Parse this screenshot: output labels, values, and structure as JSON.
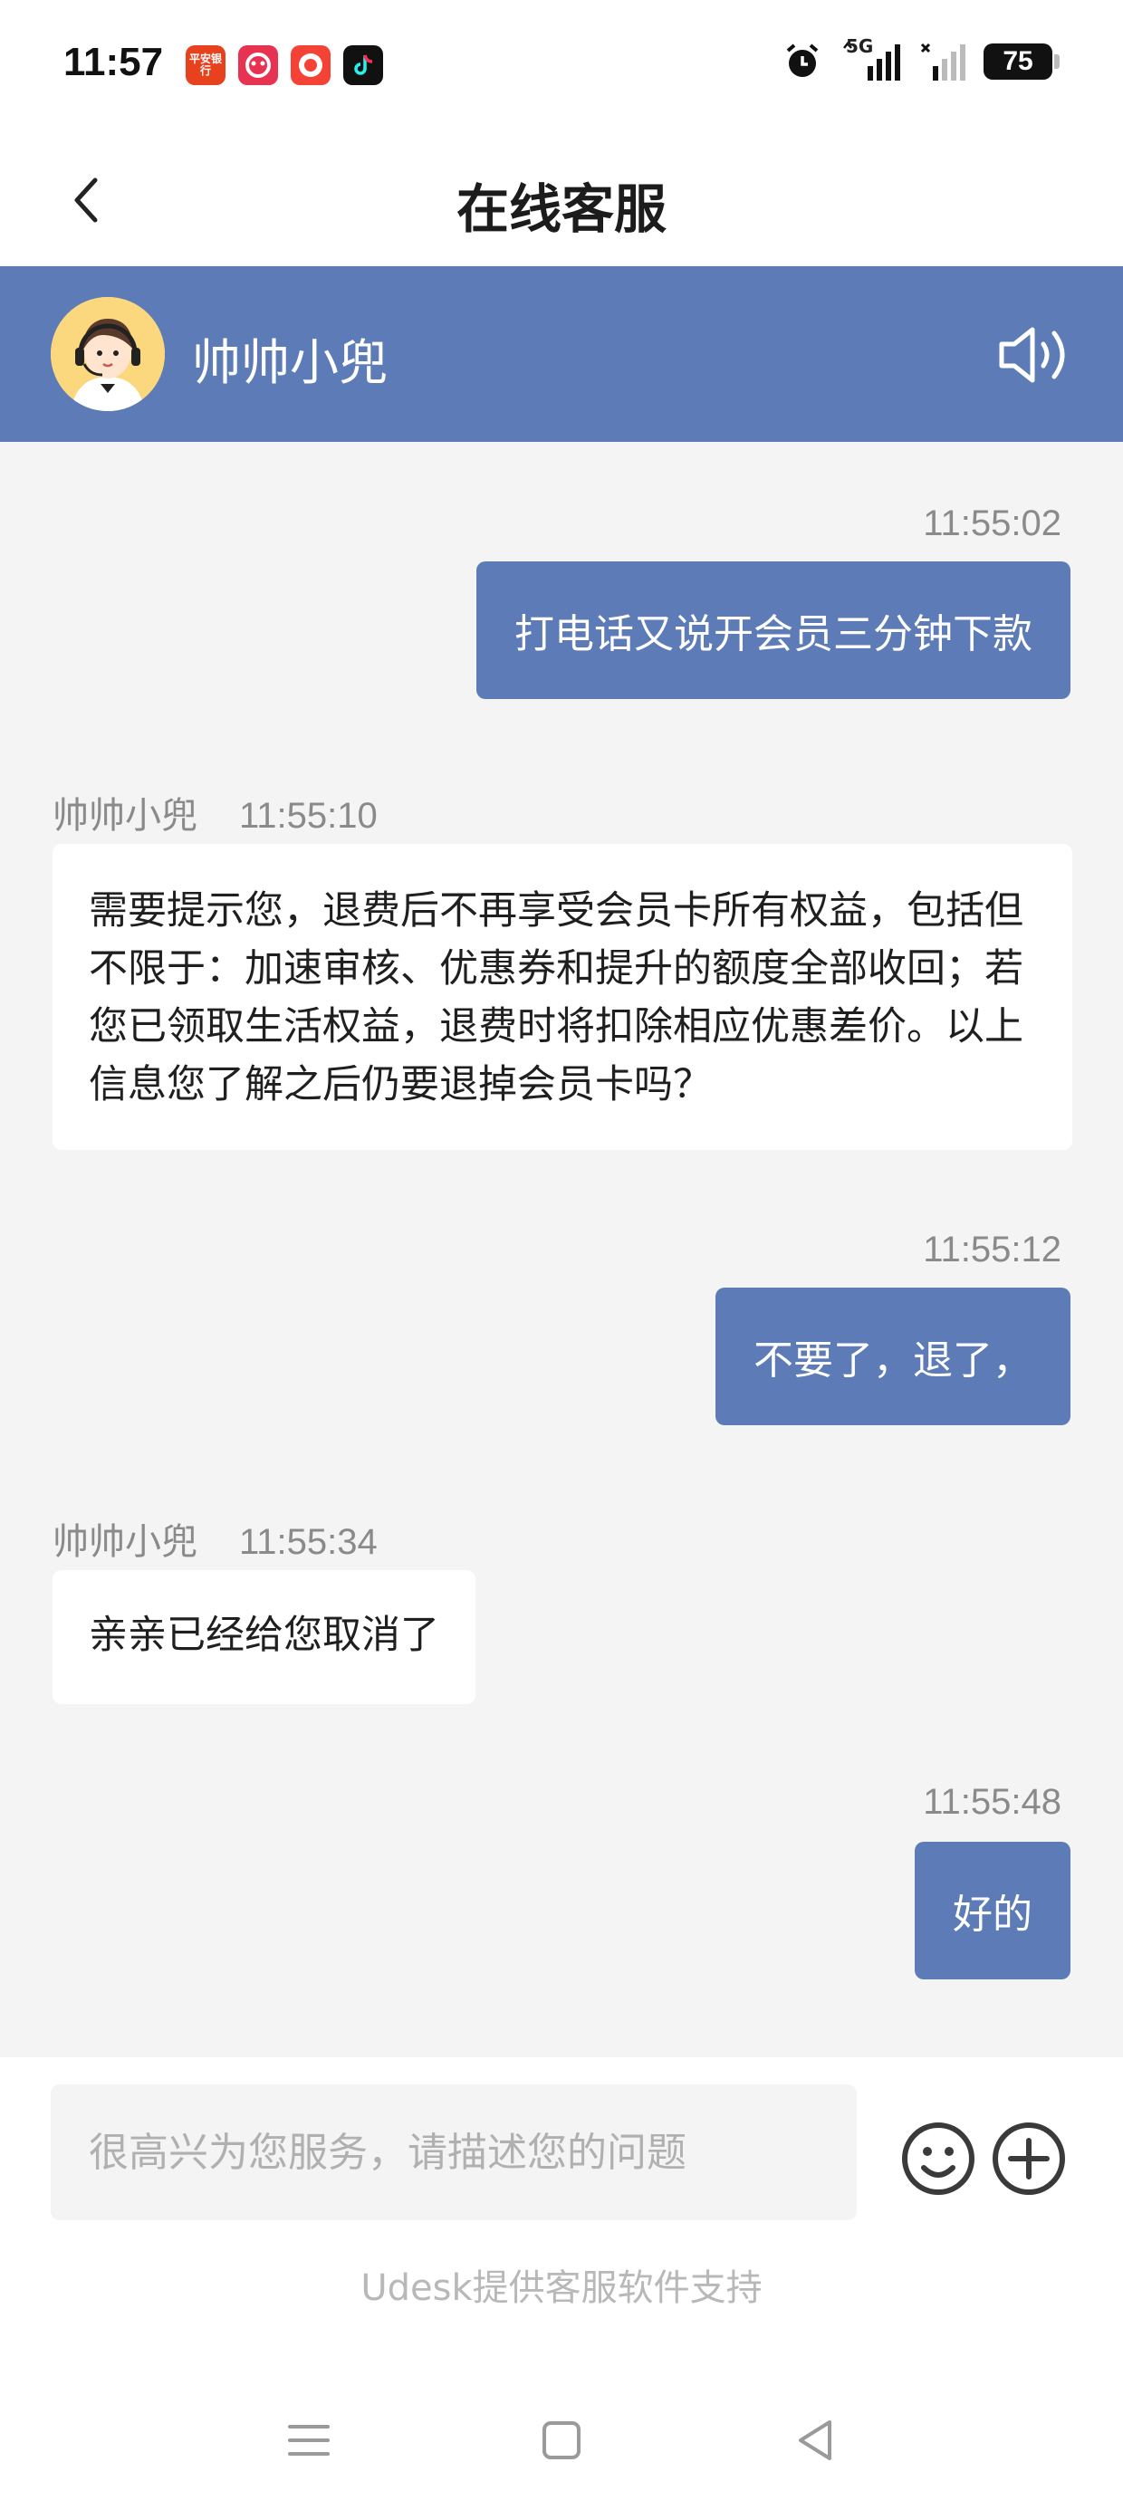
{
  "status_bar": {
    "time": "11:57",
    "apps": [
      {
        "name": "pingan-bank-icon",
        "label": "平安银行"
      },
      {
        "name": "tmall-icon",
        "label": ""
      },
      {
        "name": "pinduoduo-icon",
        "label": ""
      },
      {
        "name": "tiktok-icon",
        "label": ""
      }
    ],
    "battery": "75",
    "network": "5G"
  },
  "header": {
    "title": "在线客服"
  },
  "agent": {
    "name": "帅帅小兜"
  },
  "messages": [
    {
      "from": "user",
      "time": "11:55:02",
      "text": "打电话又说开会员三分钟下款"
    },
    {
      "from": "agent",
      "sender": "帅帅小兜",
      "time": "11:55:10",
      "text": "需要提示您，退费后不再享受会员卡所有权益，包括但不限于：加速审核、优惠券和提升的额度全部收回；若您已领取生活权益，退费时将扣除相应优惠差价。以上信息您了解之后仍要退掉会员卡吗？"
    },
    {
      "from": "user",
      "time": "11:55:12",
      "text": "不要了，退了，"
    },
    {
      "from": "agent",
      "sender": "帅帅小兜",
      "time": "11:55:34",
      "text": "亲亲已经给您取消了"
    },
    {
      "from": "user",
      "time": "11:55:48",
      "text": "好的"
    }
  ],
  "composer": {
    "placeholder": "很高兴为您服务，请描述您的问题",
    "powered_by": "Udesk提供客服软件支持"
  },
  "colors": {
    "accent": "#5d7cb7",
    "background": "#f4f4f5"
  }
}
